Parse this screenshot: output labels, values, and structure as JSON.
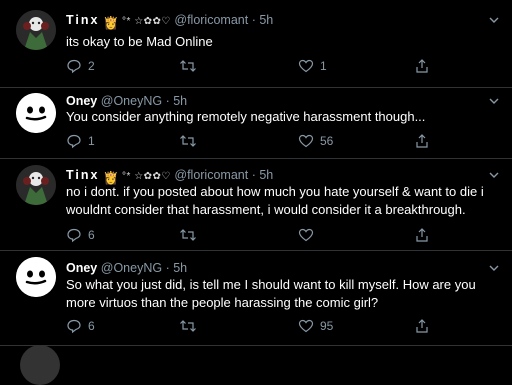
{
  "tweets": [
    {
      "name": "Tinx",
      "emoji": "👸",
      "deco": "°* ☆✿✿♡",
      "handle": "@floricomant",
      "time": "5h",
      "text": "its okay to be Mad Online",
      "replies": "2",
      "retweets": "",
      "likes": "1"
    },
    {
      "name": "Oney",
      "handle": "@OneyNG",
      "time": "5h",
      "text": "You consider anything remotely negative harassment though...",
      "replies": "1",
      "retweets": "",
      "likes": "56"
    },
    {
      "name": "Tinx",
      "emoji": "👸",
      "deco": "°* ☆✿✿♡",
      "handle": "@floricomant",
      "time": "5h",
      "text": "no i dont. if you posted about how much you hate yourself & want to die i wouldnt consider that harassment, i would consider it a breakthrough.",
      "replies": "6",
      "retweets": "",
      "likes": ""
    },
    {
      "name": "Oney",
      "handle": "@OneyNG",
      "time": "5h",
      "text": "So what you just did, is tell me I should want to kill myself. How are you more virtuos than the people harassing the comic girl?",
      "replies": "6",
      "retweets": "",
      "likes": "95"
    }
  ],
  "dot": "·",
  "colors": {
    "background": "#000000",
    "text": "#ffffff",
    "muted": "#8899a6",
    "divider": "#2f3336"
  },
  "icons": [
    "reply-icon",
    "retweet-icon",
    "like-icon",
    "share-icon",
    "chevron-down-icon",
    "crown-emoji-icon"
  ]
}
